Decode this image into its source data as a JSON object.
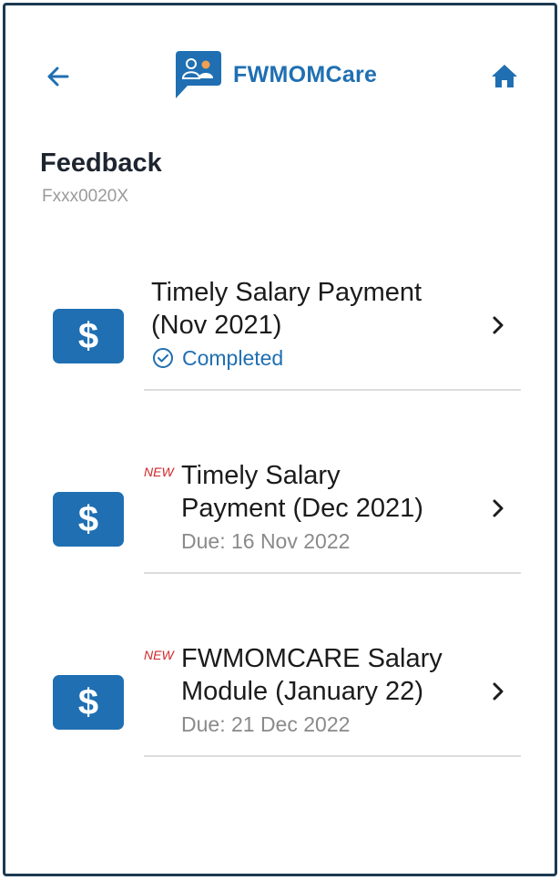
{
  "header": {
    "brand": "FWMOMCare",
    "back_icon": "arrow-back-icon",
    "home_icon": "home-icon",
    "logo_icon": "chat-users-logo-icon",
    "brand_color": "#1f6fb2"
  },
  "page": {
    "title": "Feedback",
    "subtitle": "Fxxx0020X"
  },
  "items": [
    {
      "title_line1": "Timely Salary Payment",
      "title_line2": "(Nov 2021)",
      "status": "Completed",
      "status_icon": "check-circle-icon",
      "icon": "dollar-icon",
      "is_new": false
    },
    {
      "new_label": "NEW",
      "title_line1": "Timely Salary",
      "title_line2": "Payment (Dec 2021)",
      "due": "Due: 16 Nov 2022",
      "icon": "dollar-icon",
      "is_new": true
    },
    {
      "new_label": "NEW",
      "title_line1": "FWMOMCARE Salary",
      "title_line2": "Module (January 22)",
      "due": "Due: 21 Dec 2022",
      "icon": "dollar-icon",
      "is_new": true
    }
  ],
  "colors": {
    "accent": "#1f6fb2",
    "new_tag": "#d0262a",
    "muted": "#8a8a8a"
  }
}
